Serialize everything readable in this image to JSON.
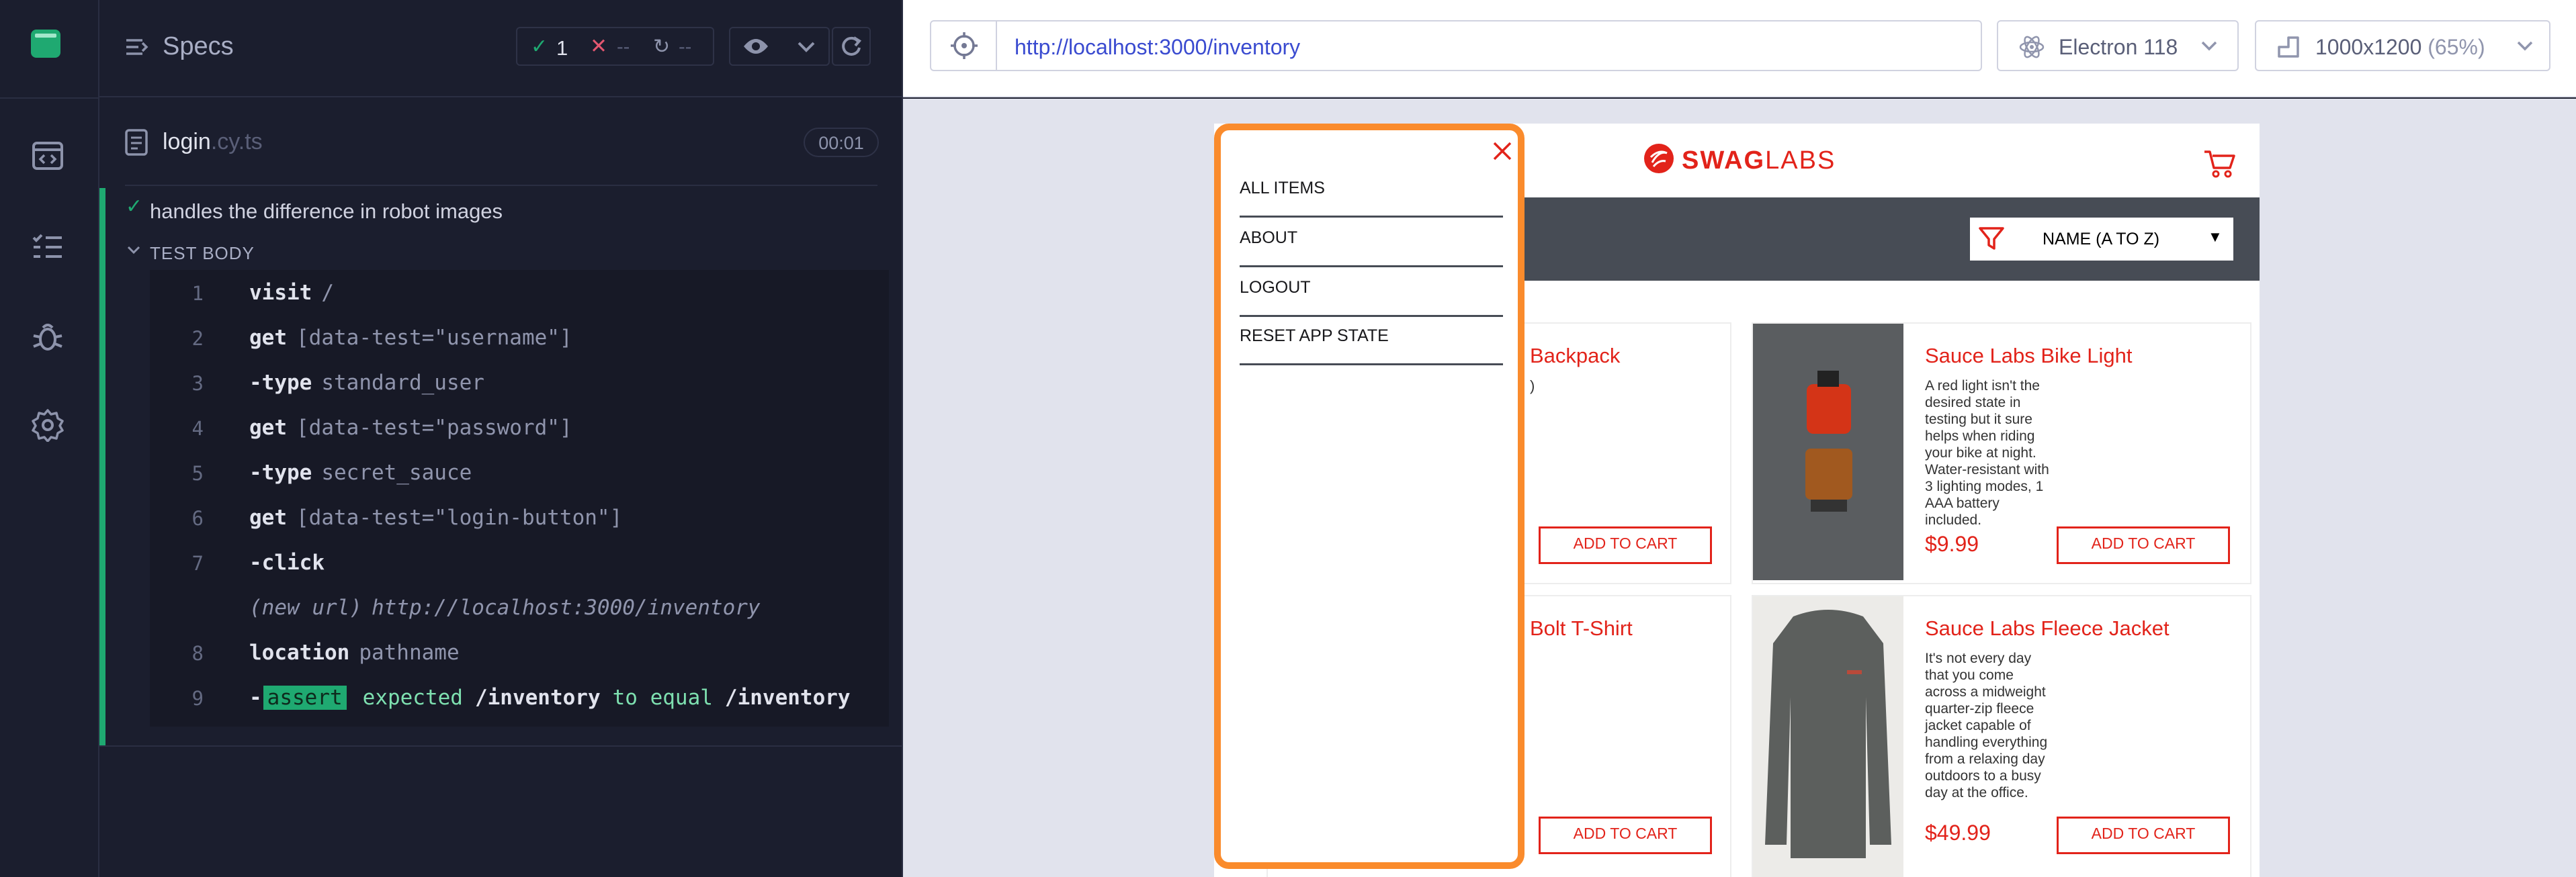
{
  "specs_header": {
    "title": "Specs",
    "pass_count": "1",
    "fail_count": "--",
    "pending_count": "--"
  },
  "spec_file": {
    "name": "login",
    "ext": ".cy.ts",
    "duration": "00:01"
  },
  "test": {
    "title": "handles the difference in robot images",
    "section": "TEST BODY",
    "commands": [
      {
        "num": "1",
        "name": "visit",
        "arg": "/"
      },
      {
        "num": "2",
        "name": "get",
        "arg": "[data-test=\"username\"]"
      },
      {
        "num": "3",
        "name": "-type",
        "arg": "standard_user"
      },
      {
        "num": "4",
        "name": "get",
        "arg": "[data-test=\"password\"]"
      },
      {
        "num": "5",
        "name": "-type",
        "arg": "secret_sauce"
      },
      {
        "num": "6",
        "name": "get",
        "arg": "[data-test=\"login-button\"]"
      },
      {
        "num": "7",
        "name": "-click",
        "arg": ""
      },
      {
        "num": "",
        "name": "(new url)",
        "arg": "http://localhost:3000/inventory"
      },
      {
        "num": "8",
        "name": "location",
        "arg": "pathname"
      },
      {
        "num": "9",
        "name": "-",
        "badge": "assert",
        "arg": "expected /inventory to equal /inventory"
      }
    ],
    "assert_parts": {
      "expected": "expected",
      "v1": "/inventory",
      "mid": "to equal",
      "v2": "/inventory"
    }
  },
  "url_bar": {
    "url": "http://localhost:3000/inventory"
  },
  "browser": {
    "label": "Electron 118"
  },
  "viewport": {
    "size": "1000x1200",
    "scale": "(65%)"
  },
  "app": {
    "logo_swag": "SWAG",
    "logo_labs": "LABS",
    "sort_label": "NAME (A TO Z)",
    "menu": [
      "ALL ITEMS",
      "ABOUT",
      "LOGOUT",
      "RESET APP STATE"
    ],
    "products": [
      {
        "name": "Backpack",
        "desc": ")",
        "price": "",
        "button": "ADD TO CART"
      },
      {
        "name": "Sauce Labs Bike Light",
        "desc": "A red light isn't the desired state in testing but it sure helps when riding your bike at night. Water-resistant with 3 lighting modes, 1 AAA battery included.",
        "price": "$9.99",
        "button": "ADD TO CART"
      },
      {
        "name": "Bolt T-Shirt",
        "desc": "",
        "price": "",
        "button": "ADD TO CART"
      },
      {
        "name": "Sauce Labs Fleece Jacket",
        "desc": "It's not every day that you come across a midweight quarter-zip fleece jacket capable of handling everything from a relaxing day outdoors to a busy day at the office.",
        "price": "$49.99",
        "button": "ADD TO CART"
      }
    ]
  },
  "colors": {
    "accent_green": "#1fa971",
    "swag_red": "#e2231a",
    "highlight_orange": "#fa8b2c",
    "link_blue": "#3a4bd0"
  }
}
